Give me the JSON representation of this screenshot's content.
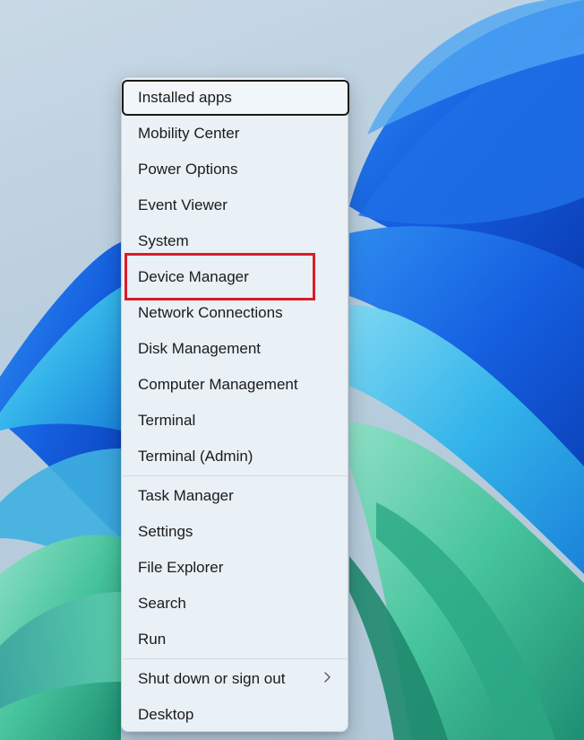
{
  "menu": {
    "group1": [
      {
        "label": "Installed apps"
      },
      {
        "label": "Mobility Center"
      },
      {
        "label": "Power Options"
      },
      {
        "label": "Event Viewer"
      },
      {
        "label": "System"
      },
      {
        "label": "Device Manager"
      },
      {
        "label": "Network Connections"
      },
      {
        "label": "Disk Management"
      },
      {
        "label": "Computer Management"
      },
      {
        "label": "Terminal"
      },
      {
        "label": "Terminal (Admin)"
      }
    ],
    "group2": [
      {
        "label": "Task Manager"
      },
      {
        "label": "Settings"
      },
      {
        "label": "File Explorer"
      },
      {
        "label": "Search"
      },
      {
        "label": "Run"
      }
    ],
    "group3": [
      {
        "label": "Shut down or sign out",
        "icon": "chevron-right-icon"
      },
      {
        "label": "Desktop"
      }
    ]
  },
  "colors": {
    "highlight": "#d81e28",
    "menu_bg": "#ecf2f8",
    "wallpaper_blue": "#1a6fe8",
    "wallpaper_cyan": "#3fc3e6",
    "wallpaper_green": "#4fc29a"
  }
}
